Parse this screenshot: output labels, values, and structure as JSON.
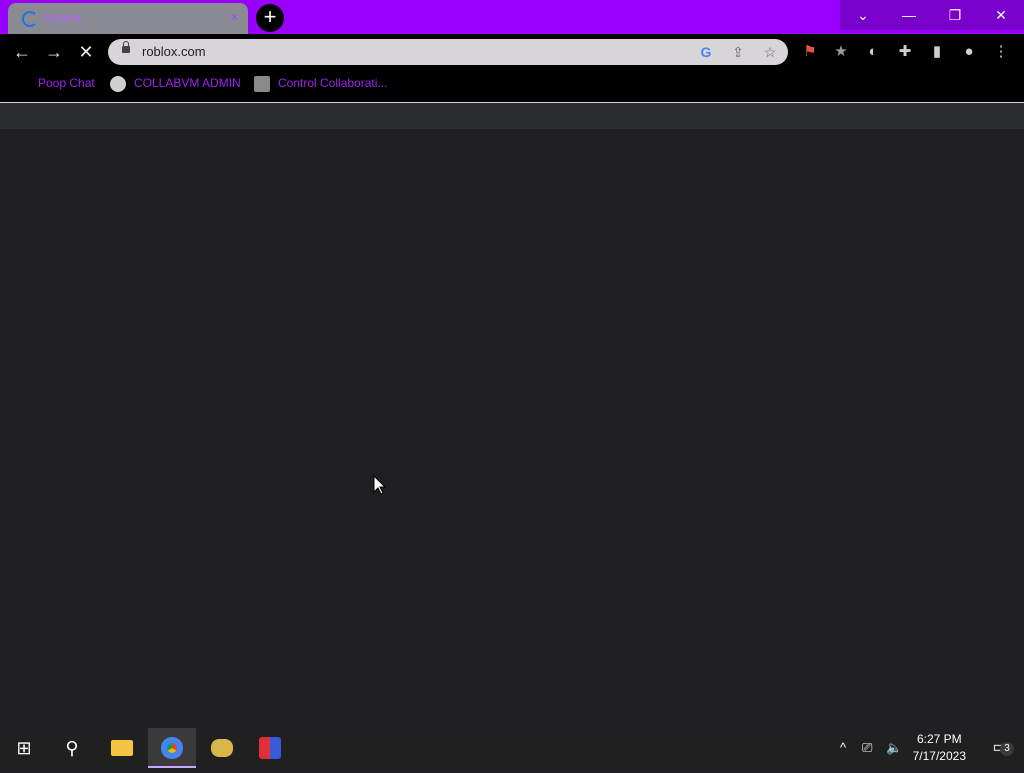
{
  "browser": {
    "tab": {
      "title": "Roblox",
      "close": "×"
    },
    "new_tab": "+",
    "window_controls": {
      "tab_search": "⌄",
      "minimize": "—",
      "restore": "❐",
      "close": "✕"
    },
    "toolbar": {
      "back": "←",
      "forward": "→",
      "stop": "✕",
      "url": "roblox.com",
      "google_icon": "G",
      "share_icon": "⇪",
      "star_icon": "☆"
    },
    "extensions": [
      "⚑",
      "★",
      "◐",
      "✚",
      "▮",
      "●",
      "⋮"
    ],
    "bookmarks": [
      {
        "label": "Poop Chat"
      },
      {
        "label": "COLLABVM ADMIN"
      },
      {
        "label": "Control Collaborati..."
      }
    ]
  },
  "taskbar": {
    "start": "⊞",
    "search": "⚲",
    "apps": [
      "file-explorer",
      "chrome",
      "bee-app",
      "paint-app"
    ],
    "tray": {
      "chevron": "^",
      "network": "⎚",
      "volume": "🔈"
    },
    "time": "6:27 PM",
    "date": "7/17/2023",
    "notifications_count": "3"
  },
  "colors": {
    "titlebar": "#9a00ff",
    "bookmark_text": "#a020f0",
    "page_bg": "#1f1f21"
  }
}
